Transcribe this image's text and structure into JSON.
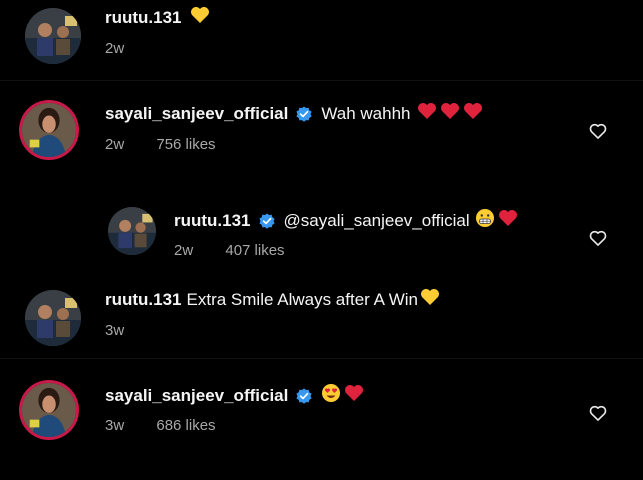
{
  "comments": [
    {
      "username": "ruutu.131",
      "text": "",
      "time": "2w",
      "likes": "",
      "emoji": [
        "yellow-heart"
      ]
    },
    {
      "username": "sayali_sanjeev_official",
      "text": "Wah wahhh",
      "time": "2w",
      "likes": "756 likes",
      "emoji": [
        "red-heart",
        "red-heart",
        "red-heart"
      ]
    },
    {
      "username": "ruutu.131",
      "text": "@sayali_sanjeev_official",
      "time": "2w",
      "likes": "407 likes",
      "emoji": [
        "grimacing-face",
        "red-heart"
      ]
    },
    {
      "username": "ruutu.131",
      "text": "Extra Smile Always after A Win",
      "time": "3w",
      "likes": "",
      "emoji": [
        "yellow-heart"
      ]
    },
    {
      "username": "sayali_sanjeev_official",
      "text": "",
      "time": "3w",
      "likes": "686 likes",
      "emoji": [
        "heart-eyes-face",
        "red-heart"
      ]
    }
  ],
  "colors": {
    "background": "#000000",
    "verified": "#3897f0",
    "ring": "#c9184a",
    "meta": "#a8a8a8"
  },
  "icons": [
    "verified-badge-icon",
    "heart-outline-icon",
    "yellow-heart-emoji",
    "red-heart-emoji",
    "grimacing-face-emoji",
    "heart-eyes-face-emoji"
  ]
}
